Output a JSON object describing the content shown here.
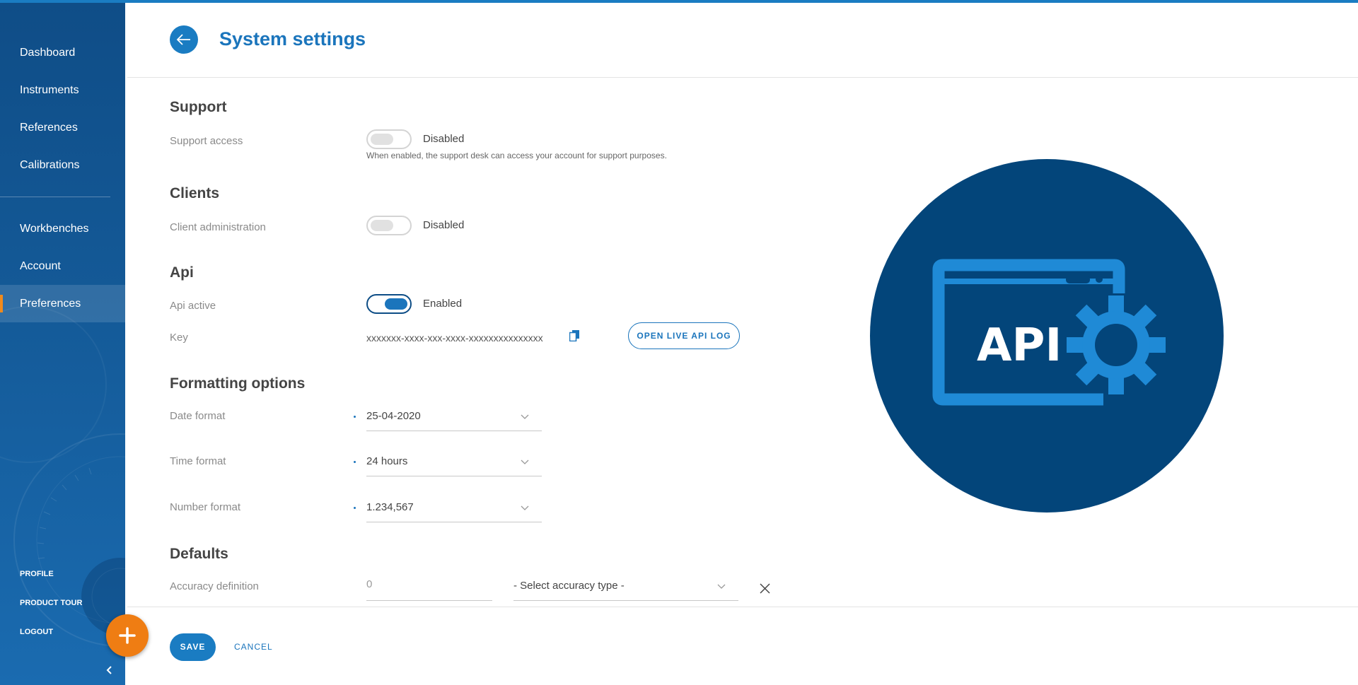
{
  "colors": {
    "brand_blue": "#1b75bc",
    "sidebar": "#0f4d87",
    "accent_orange": "#ef7d13",
    "illustration_navy": "#03457a"
  },
  "sidebar": {
    "primary": [
      {
        "label": "Dashboard"
      },
      {
        "label": "Instruments"
      },
      {
        "label": "References"
      },
      {
        "label": "Calibrations"
      }
    ],
    "secondary": [
      {
        "label": "Workbenches"
      },
      {
        "label": "Account"
      },
      {
        "label": "Preferences",
        "active": true
      }
    ],
    "bottom_links": [
      {
        "label": "PROFILE"
      },
      {
        "label": "PRODUCT TOUR"
      },
      {
        "label": "LOGOUT"
      }
    ],
    "collapse_icon": "chevron-left-icon",
    "fab_icon": "plus-icon"
  },
  "header": {
    "title": "System settings",
    "back_icon": "arrow-left-icon"
  },
  "support": {
    "title": "Support",
    "access_label": "Support access",
    "access_state": "Disabled",
    "access_hint": "When enabled, the support desk can access your account for support purposes."
  },
  "clients": {
    "title": "Clients",
    "admin_label": "Client administration",
    "admin_state": "Disabled"
  },
  "api": {
    "title": "Api",
    "active_label": "Api active",
    "active_state": "Enabled",
    "key_label": "Key",
    "key_value": "xxxxxxx-xxxx-xxx-xxxx-xxxxxxxxxxxxxxx",
    "copy_icon": "copy-icon",
    "log_button": "OPEN LIVE API LOG"
  },
  "formatting": {
    "title": "Formatting options",
    "date_label": "Date format",
    "date_value": "25-04-2020",
    "time_label": "Time format",
    "time_value": "24 hours",
    "number_label": "Number format",
    "number_value": "1.234,567"
  },
  "defaults": {
    "title": "Defaults",
    "accuracy_label": "Accuracy definition",
    "accuracy_placeholder": "0",
    "accuracy_type_value": "- Select accuracy type -"
  },
  "footer": {
    "save": "SAVE",
    "cancel": "CANCEL"
  },
  "illustration": {
    "text": "API",
    "icon": "api-gear-icon"
  }
}
